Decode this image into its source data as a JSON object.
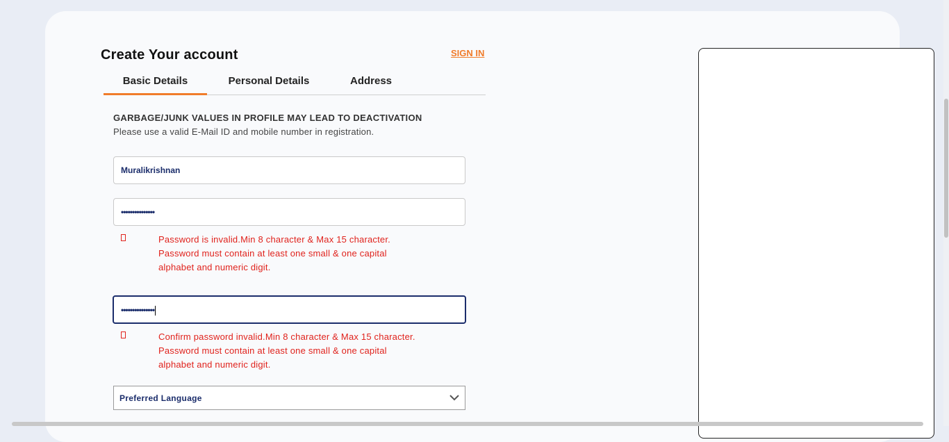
{
  "form": {
    "title": "Create Your account",
    "sign_in_label": "SIGN IN",
    "tabs": [
      {
        "label": "Basic Details",
        "active": true
      },
      {
        "label": "Personal Details",
        "active": false
      },
      {
        "label": "Address",
        "active": false
      }
    ],
    "warning_heading": "GARBAGE/JUNK VALUES IN PROFILE MAY LEAD TO DEACTIVATION",
    "warning_subtext": "Please use a valid E-Mail ID and mobile number in registration.",
    "username_value": "Muralikrishnan",
    "password_masked": "•••••••••••••••",
    "password_error": [
      "Password is invalid.Min 8 character & Max 15 character.",
      "Password must contain at least one small & one capital",
      "alphabet and numeric digit."
    ],
    "confirm_password_masked": "•••••••••••••••",
    "confirm_password_error": [
      "Confirm password invalid.Min 8 character & Max 15 character.",
      "Password must contain at least one small & one capital",
      "alphabet and numeric digit."
    ],
    "language_select_label": "Preferred Language"
  },
  "colors": {
    "accent": "#f07c2a",
    "error": "#e0221c",
    "input_text": "#1b2d6b",
    "background": "#e9edf5"
  },
  "icons": {
    "error": "error-icon",
    "dropdown": "chevron-down-icon"
  }
}
